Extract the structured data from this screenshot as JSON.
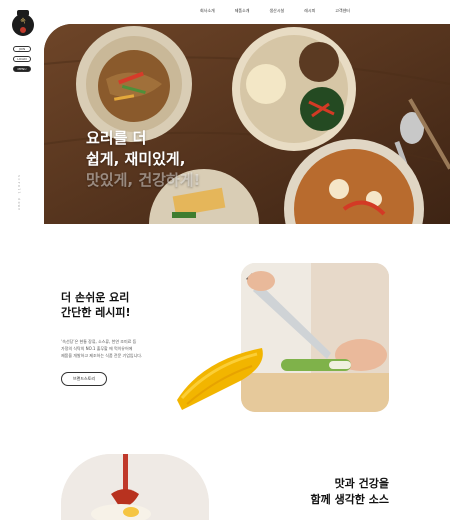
{
  "sidebar": {
    "logo_icon": "brand-logo-icon",
    "buttons": [
      "JOIN",
      "LOGIN",
      "MENU"
    ],
    "vertical_text": "scroll down"
  },
  "nav": {
    "items": [
      "회사소개",
      "제품소개",
      "생산시설",
      "레시피",
      "고객센터"
    ]
  },
  "hero": {
    "line1": "요리를 더",
    "line2": "쉽게, 재미있게,",
    "line3": "맛있게, 건강하게!"
  },
  "section2": {
    "title_line1": "더 손쉬운 요리",
    "title_line2": "간단한 레시피!",
    "desc_line1": "‘속선당’은 현통 장류, 소스류, 천연 조미료 등",
    "desc_line2": "가정의 식탁의 NO.1 출무할 에 먹이유어에",
    "desc_line3": "제품을 개발하고 제조하는 식품 전문 기업입니다.",
    "button_label": "브랜드스토리"
  },
  "section3": {
    "title_line1": "맛과 건강을",
    "title_line2": "함께 생각한 소스"
  },
  "colors": {
    "hero_bg": "#5c3a22",
    "accent_yellow": "#f2b500",
    "text_dark": "#111111"
  }
}
